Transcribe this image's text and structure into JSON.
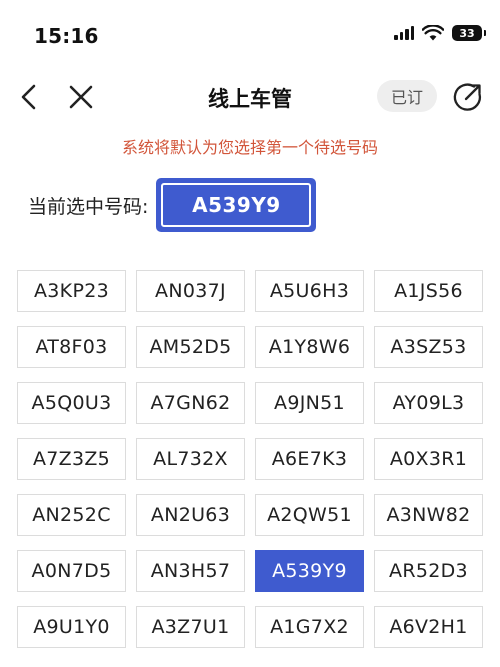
{
  "status_bar": {
    "time": "15:16",
    "battery": "33",
    "icons": [
      "signal-icon",
      "wifi-icon",
      "battery-icon"
    ]
  },
  "nav": {
    "title": "线上车管",
    "subscribed_label": "已订",
    "icons": [
      "back-arrow-icon",
      "close-icon",
      "share-icon"
    ]
  },
  "notice": "系统将默认为您选择第一个待选号码",
  "current": {
    "label": "当前选中号码:",
    "plate": "A539Y9"
  },
  "plates": [
    "A3KP23",
    "AN037J",
    "A5U6H3",
    "A1JS56",
    "AT8F03",
    "AM52D5",
    "A1Y8W6",
    "A3SZ53",
    "A5Q0U3",
    "A7GN62",
    "A9JN51",
    "AY09L3",
    "A7Z3Z5",
    "AL732X",
    "A6E7K3",
    "A0X3R1",
    "AN252C",
    "AN2U63",
    "A2QW51",
    "A3NW82",
    "A0N7D5",
    "AN3H57",
    "A539Y9",
    "AR52D3",
    "A9U1Y0",
    "A3Z7U1",
    "A1G7X2",
    "A6V2H1"
  ],
  "selected_plate": "A539Y9",
  "colors": {
    "accent": "#3f5bcf",
    "notice": "#d2553a"
  }
}
